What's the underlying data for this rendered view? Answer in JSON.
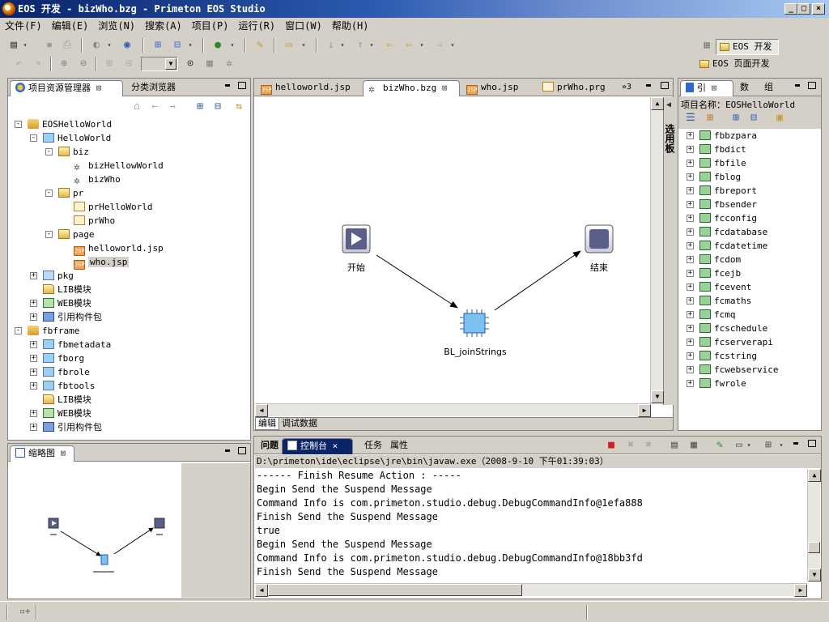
{
  "window": {
    "title": "EOS 开发 - bizWho.bzg - Primeton EOS Studio"
  },
  "menu": [
    "文件(F)",
    "编辑(E)",
    "浏览(N)",
    "搜索(A)",
    "项目(P)",
    "运行(R)",
    "窗口(W)",
    "帮助(H)"
  ],
  "perspectives": {
    "active": "EOS 开发",
    "other": "EOS 页面开发"
  },
  "explorer": {
    "tabs": [
      "项目资源管理器",
      "分类浏览器"
    ],
    "tree": [
      {
        "label": "EOSHelloWorld",
        "depth": 0,
        "icon": "project-icon",
        "exp": "-"
      },
      {
        "label": "HelloWorld",
        "depth": 1,
        "icon": "module-icon",
        "exp": "-"
      },
      {
        "label": "biz",
        "depth": 2,
        "icon": "biz-folder-icon",
        "exp": "-"
      },
      {
        "label": "bizHellowWorld",
        "depth": 3,
        "icon": "gear-icon",
        "exp": ""
      },
      {
        "label": "bizWho",
        "depth": 3,
        "icon": "gear-icon",
        "exp": ""
      },
      {
        "label": "pr",
        "depth": 2,
        "icon": "folder-icon",
        "exp": "-"
      },
      {
        "label": "prHelloWorld",
        "depth": 3,
        "icon": "process-icon",
        "exp": ""
      },
      {
        "label": "prWho",
        "depth": 3,
        "icon": "process-icon",
        "exp": ""
      },
      {
        "label": "page",
        "depth": 2,
        "icon": "folder-icon",
        "exp": "-"
      },
      {
        "label": "helloworld.jsp",
        "depth": 3,
        "icon": "jsp-icon",
        "exp": ""
      },
      {
        "label": "who.jsp",
        "depth": 3,
        "icon": "jsp-icon",
        "exp": "",
        "selected": true
      },
      {
        "label": "pkg",
        "depth": 1,
        "icon": "package-icon",
        "exp": "+"
      },
      {
        "label": "LIB模块",
        "depth": 1,
        "icon": "lib-icon",
        "exp": ""
      },
      {
        "label": "WEB模块",
        "depth": 1,
        "icon": "web-icon",
        "exp": "+"
      },
      {
        "label": "引用构件包",
        "depth": 1,
        "icon": "reference-icon",
        "exp": "+"
      },
      {
        "label": "fbframe",
        "depth": 0,
        "icon": "project-icon",
        "exp": "-"
      },
      {
        "label": "fbmetadata",
        "depth": 1,
        "icon": "module-icon",
        "exp": "+"
      },
      {
        "label": "fborg",
        "depth": 1,
        "icon": "module-icon",
        "exp": "+"
      },
      {
        "label": "fbrole",
        "depth": 1,
        "icon": "module-icon",
        "exp": "+"
      },
      {
        "label": "fbtools",
        "depth": 1,
        "icon": "module-icon",
        "exp": "+"
      },
      {
        "label": "LIB模块",
        "depth": 1,
        "icon": "lib-icon",
        "exp": ""
      },
      {
        "label": "WEB模块",
        "depth": 1,
        "icon": "web-icon",
        "exp": "+"
      },
      {
        "label": "引用构件包",
        "depth": 1,
        "icon": "reference-icon",
        "exp": "+"
      }
    ]
  },
  "outline": {
    "tab": "缩略图"
  },
  "editor": {
    "tabs": [
      {
        "label": "helloworld.jsp",
        "icon": "jsp-icon"
      },
      {
        "label": "bizWho.bzg",
        "icon": "gear-icon",
        "active": true
      },
      {
        "label": "who.jsp",
        "icon": "jsp-icon"
      },
      {
        "label": "prWho.prg",
        "icon": "process-icon"
      }
    ],
    "overflow": "»3",
    "palette_label": "选用板",
    "nodes": {
      "start": "开始",
      "end": "结束",
      "logic": "BL_joinStrings"
    },
    "bottom_tabs": [
      "编辑",
      "调试数据"
    ]
  },
  "right_panel": {
    "tabs": [
      "引",
      "数",
      "组"
    ],
    "project_label": "项目名称：EOSHelloWorld",
    "items": [
      "fbbzpara",
      "fbdict",
      "fbfile",
      "fblog",
      "fbreport",
      "fbsender",
      "fcconfig",
      "fcdatabase",
      "fcdatetime",
      "fcdom",
      "fcejb",
      "fcevent",
      "fcmaths",
      "fcmq",
      "fcschedule",
      "fcserverapi",
      "fcstring",
      "fcwebservice",
      "fwrole"
    ]
  },
  "console": {
    "tabs": [
      "问题",
      "控制台",
      "任务",
      "属性"
    ],
    "active_tab": "控制台",
    "path": "D:\\primeton\\ide\\eclipse\\jre\\bin\\javaw.exe（2008-9-10 下午01:39:03）",
    "lines": [
      "------ Finish Resume Action : -----",
      "Begin Send the Suspend Message",
      "Command Info is com.primeton.studio.debug.DebugCommandInfo@1efa888",
      "Finish Send the Suspend Message",
      "true",
      "Begin Send the Suspend Message",
      "Command Info is com.primeton.studio.debug.DebugCommandInfo@18bb3fd",
      "Finish Send the Suspend Message"
    ]
  }
}
